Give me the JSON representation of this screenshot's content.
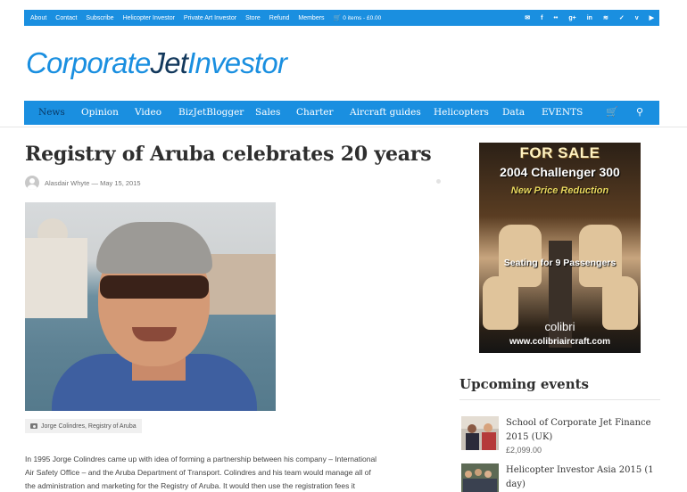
{
  "topbar": {
    "links": [
      "About",
      "Contact",
      "Subscribe",
      "Helicopter Investor",
      "Private Art Investor",
      "Store",
      "Refund",
      "Members"
    ],
    "cart_label": "0 items - £0.00",
    "social_icons": [
      "envelope-icon",
      "facebook-icon",
      "flickr-icon",
      "google-plus-icon",
      "linkedin-icon",
      "rss-icon",
      "twitter-icon",
      "vimeo-icon",
      "youtube-icon"
    ],
    "accent_color": "#1a8fe0"
  },
  "logo": {
    "part1": "Corporate",
    "part2": "Jet",
    "part3": "Investor"
  },
  "nav": {
    "items": [
      "News",
      "Opinion",
      "Video",
      "BizJetBlogger",
      "Sales",
      "Charter",
      "Aircraft guides",
      "Helicopters",
      "Data",
      "EVENTS"
    ],
    "active": "News",
    "icons": [
      "cart-icon",
      "search-icon"
    ]
  },
  "article": {
    "title": "Registry of Aruba celebrates 20 years",
    "byline": "Alasdair Whyte — May 15, 2015",
    "caption": "Jorge Colindres, Registry of Aruba",
    "body_lines": [
      "In 1995 Jorge Colindres came up with idea of forming a partnership between his company – International",
      "Air Safety Office – and the Aruba Department of Transport. Colindres and his team would manage all of",
      "the administration and marketing for the Registry of Aruba. It would then use the registration fees it"
    ]
  },
  "ad": {
    "headline": "FOR SALE",
    "model": "2004 Challenger 300",
    "price_note": "New Price Reduction",
    "seating": "Seating for 9 Passengers",
    "brand": "colibri",
    "url": "www.colibriaircraft.com"
  },
  "events": {
    "heading": "Upcoming events",
    "items": [
      {
        "title": "School of Corporate Jet Finance 2015 (UK)",
        "price": "£2,099.00"
      },
      {
        "title": "Helicopter Investor Asia 2015 (1 day)",
        "price": ""
      }
    ]
  }
}
